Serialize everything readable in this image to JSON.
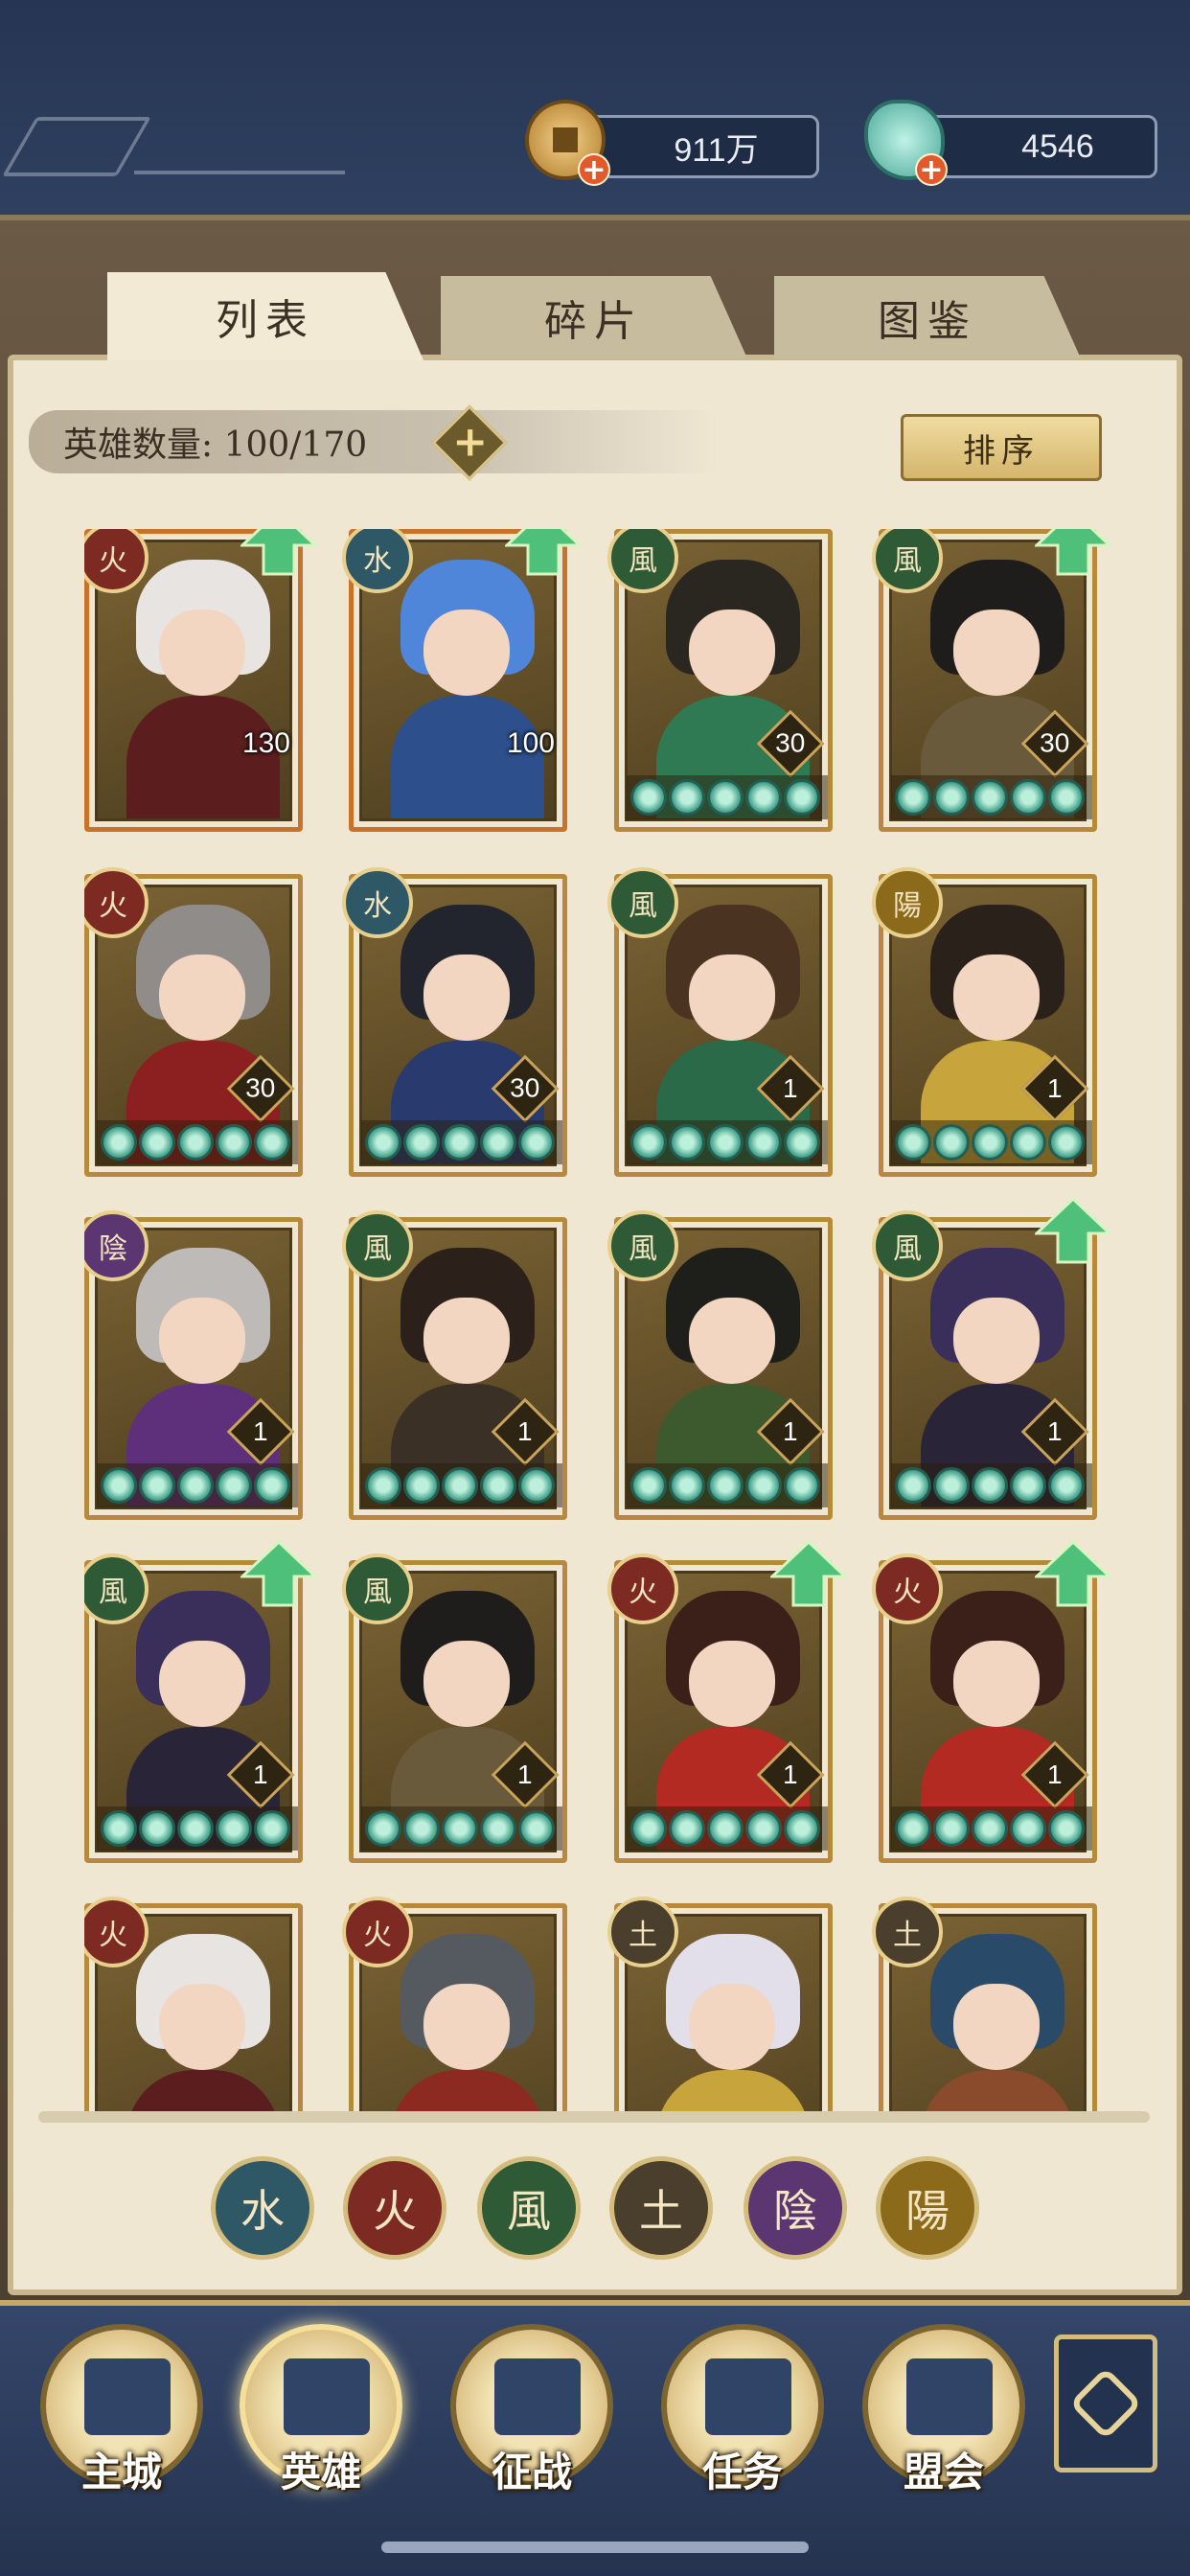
{
  "resources": {
    "coins": "911万",
    "jade": "4546"
  },
  "tabs": [
    "列表",
    "碎片",
    "图鉴"
  ],
  "hero_count_label": "英雄数量: 100/170",
  "sort_label": "排序",
  "element_colors": {
    "水": "#2f5866",
    "火": "#7c2a22",
    "風": "#2f5a36",
    "土": "#4a3e2c",
    "陰": "#5b3670",
    "陽": "#8c6a1c"
  },
  "heroes": [
    {
      "element": "火",
      "upgrade": true,
      "level": "130",
      "level_style": "plain",
      "stars": 0,
      "hair": "#e8e4e2",
      "outfit": "#5b1d1d",
      "frame": "#c9732a"
    },
    {
      "element": "水",
      "upgrade": true,
      "level": "100",
      "level_style": "plain",
      "stars": 0,
      "hair": "#4f86d9",
      "outfit": "#2d4f8c",
      "frame": "#c9732a"
    },
    {
      "element": "風",
      "upgrade": false,
      "level": "30",
      "level_style": "diamond",
      "stars": 5,
      "hair": "#2a2620",
      "outfit": "#2f7a52",
      "frame": "#b7893c"
    },
    {
      "element": "風",
      "upgrade": true,
      "level": "30",
      "level_style": "diamond",
      "stars": 5,
      "hair": "#1f1d1c",
      "outfit": "#6a5a3c",
      "frame": "#b7893c"
    },
    {
      "element": "火",
      "upgrade": false,
      "level": "30",
      "level_style": "diamond",
      "stars": 5,
      "hair": "#8f8c8a",
      "outfit": "#8c1f1f",
      "frame": "#b7893c"
    },
    {
      "element": "水",
      "upgrade": false,
      "level": "30",
      "level_style": "diamond",
      "stars": 5,
      "hair": "#22252e",
      "outfit": "#283a6e",
      "frame": "#b7893c"
    },
    {
      "element": "風",
      "upgrade": false,
      "level": "1",
      "level_style": "diamond",
      "stars": 5,
      "hair": "#4a3320",
      "outfit": "#2a6a48",
      "frame": "#b7893c"
    },
    {
      "element": "陽",
      "upgrade": false,
      "level": "1",
      "level_style": "diamond",
      "stars": 5,
      "hair": "#2a221a",
      "outfit": "#c8a43c",
      "frame": "#b7893c"
    },
    {
      "element": "陰",
      "upgrade": false,
      "level": "1",
      "level_style": "diamond",
      "stars": 5,
      "hair": "#bdbab7",
      "outfit": "#5e2f7a",
      "frame": "#b7893c"
    },
    {
      "element": "風",
      "upgrade": false,
      "level": "1",
      "level_style": "diamond",
      "stars": 5,
      "hair": "#2b211a",
      "outfit": "#3a3026",
      "frame": "#b7893c"
    },
    {
      "element": "風",
      "upgrade": false,
      "level": "1",
      "level_style": "diamond",
      "stars": 5,
      "hair": "#1e1f1a",
      "outfit": "#3d5a2e",
      "frame": "#b7893c"
    },
    {
      "element": "風",
      "upgrade": true,
      "level": "1",
      "level_style": "diamond",
      "stars": 5,
      "hair": "#3a2e5a",
      "outfit": "#2a2438",
      "frame": "#b7893c"
    },
    {
      "element": "風",
      "upgrade": true,
      "level": "1",
      "level_style": "diamond",
      "stars": 5,
      "hair": "#3a2e5a",
      "outfit": "#2a2438",
      "frame": "#b7893c"
    },
    {
      "element": "風",
      "upgrade": false,
      "level": "1",
      "level_style": "diamond",
      "stars": 5,
      "hair": "#1f1d1c",
      "outfit": "#6a5a3c",
      "frame": "#b7893c"
    },
    {
      "element": "火",
      "upgrade": true,
      "level": "1",
      "level_style": "diamond",
      "stars": 5,
      "hair": "#3a2018",
      "outfit": "#b22a22",
      "frame": "#b7893c"
    },
    {
      "element": "火",
      "upgrade": true,
      "level": "1",
      "level_style": "diamond",
      "stars": 5,
      "hair": "#3a2018",
      "outfit": "#b22a22",
      "frame": "#b7893c"
    },
    {
      "element": "火",
      "upgrade": false,
      "level": "",
      "level_style": "none",
      "stars": 0,
      "hair": "#e8e4e2",
      "outfit": "#5b1d1d",
      "frame": "#b7893c"
    },
    {
      "element": "火",
      "upgrade": false,
      "level": "",
      "level_style": "none",
      "stars": 0,
      "hair": "#555a60",
      "outfit": "#8c2a22",
      "frame": "#b7893c"
    },
    {
      "element": "土",
      "upgrade": false,
      "level": "",
      "level_style": "none",
      "stars": 0,
      "hair": "#e2deea",
      "outfit": "#c8a43c",
      "frame": "#b7893c"
    },
    {
      "element": "土",
      "upgrade": false,
      "level": "",
      "level_style": "none",
      "stars": 0,
      "hair": "#2a4a6a",
      "outfit": "#8a4a2c",
      "frame": "#b7893c"
    }
  ],
  "element_filters": [
    "水",
    "火",
    "風",
    "土",
    "陰",
    "陽"
  ],
  "bottom_nav": [
    "主城",
    "英雄",
    "征战",
    "任务",
    "盟会"
  ],
  "bottom_nav_active": "英雄"
}
